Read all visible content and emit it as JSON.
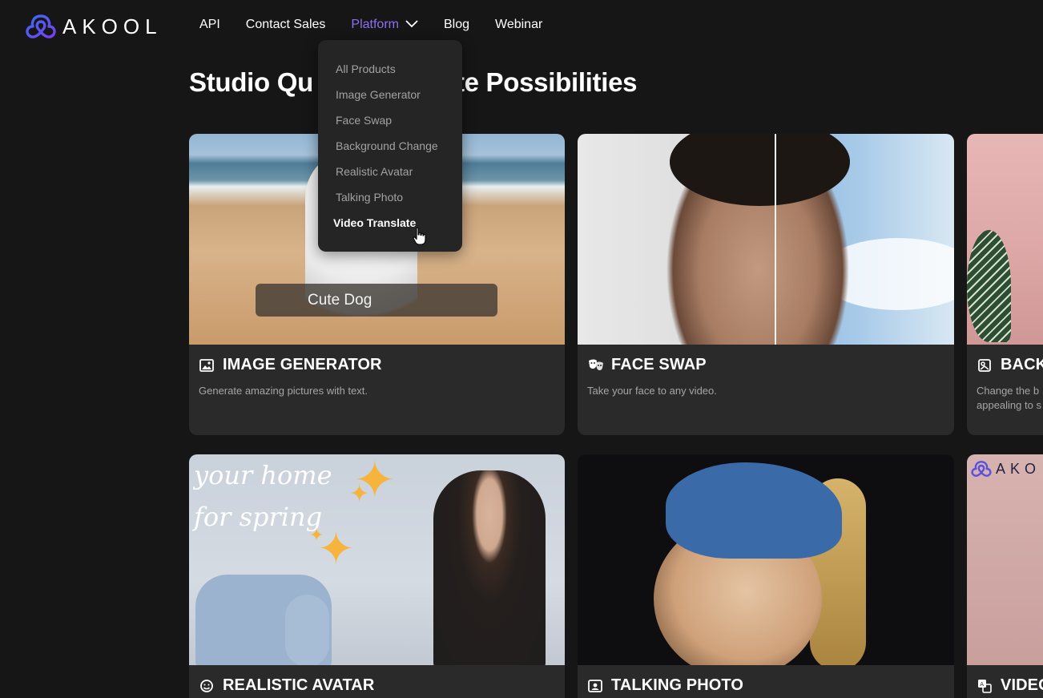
{
  "header": {
    "logo_text": "AKOOL",
    "nav": [
      {
        "label": "API"
      },
      {
        "label": "Contact Sales"
      },
      {
        "label": "Platform"
      },
      {
        "label": "Blog"
      },
      {
        "label": "Webinar"
      }
    ]
  },
  "colors": {
    "background": "#161616",
    "card": "#2a2a2a",
    "accent": "#8b6ff5",
    "dropdown": "#252525"
  },
  "main": {
    "title_left": "Studio Qu",
    "title_right": "te Possibilities"
  },
  "dropdown": {
    "items": [
      {
        "label": "All Products"
      },
      {
        "label": "Image Generator"
      },
      {
        "label": "Face Swap"
      },
      {
        "label": "Background Change"
      },
      {
        "label": "Realistic Avatar"
      },
      {
        "label": "Talking Photo"
      },
      {
        "label": "Video Translate"
      }
    ],
    "hovered": "Video Translate"
  },
  "cards": [
    {
      "icon": "image-icon",
      "title": "IMAGE GENERATOR",
      "desc": "Generate amazing pictures with text.",
      "caption": "Cute Dog"
    },
    {
      "icon": "mask-icon",
      "title": "FACE SWAP",
      "desc": "Take your face to any video."
    },
    {
      "icon": "background-icon",
      "title": "BACK",
      "desc_line1": "Change the b",
      "desc_line2": "appealing to s"
    },
    {
      "icon": "avatar-icon",
      "title": "REALISTIC AVATAR",
      "overlay_line1": "your home",
      "overlay_line2": "for spring"
    },
    {
      "icon": "photo-icon",
      "title": "TALKING PHOTO"
    },
    {
      "icon": "translate-icon",
      "title": "VIDEO",
      "overlay_logo": "AKO"
    }
  ]
}
